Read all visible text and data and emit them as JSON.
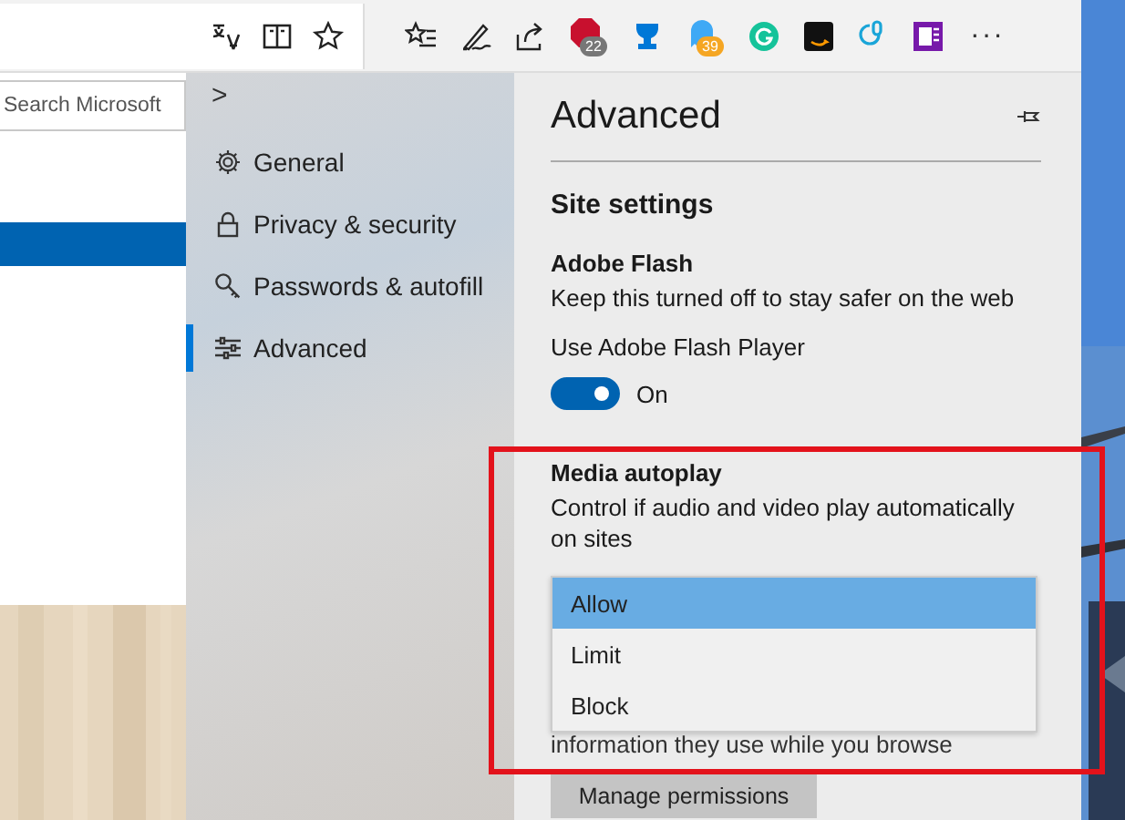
{
  "toolbar": {
    "adblock_badge": "22",
    "ghost_badge": "39",
    "more": "···"
  },
  "page": {
    "search": {
      "placeholder": "Search Microsoft"
    }
  },
  "sidebar": {
    "collapse": ">",
    "items": [
      {
        "kind": "gear",
        "label": "General",
        "selected": false
      },
      {
        "kind": "lock",
        "label": "Privacy & security",
        "selected": false
      },
      {
        "kind": "key",
        "label": "Passwords & autofill",
        "selected": false
      },
      {
        "kind": "sliders",
        "label": "Advanced",
        "selected": true
      }
    ]
  },
  "panel": {
    "title": "Advanced",
    "section": "Site settings",
    "flash": {
      "heading": "Adobe Flash",
      "description": "Keep this turned off to stay safer on the web",
      "label": "Use Adobe Flash Player",
      "on": true,
      "state_text": "On"
    },
    "autoplay": {
      "heading": "Media autoplay",
      "description": "Control if audio and video play automatically on sites",
      "options": [
        {
          "label": "Allow",
          "selected": true
        },
        {
          "label": "Limit",
          "selected": false
        },
        {
          "label": "Block",
          "selected": false
        }
      ]
    },
    "partial_text": "information they use while you browse",
    "button": "Manage permissions"
  }
}
